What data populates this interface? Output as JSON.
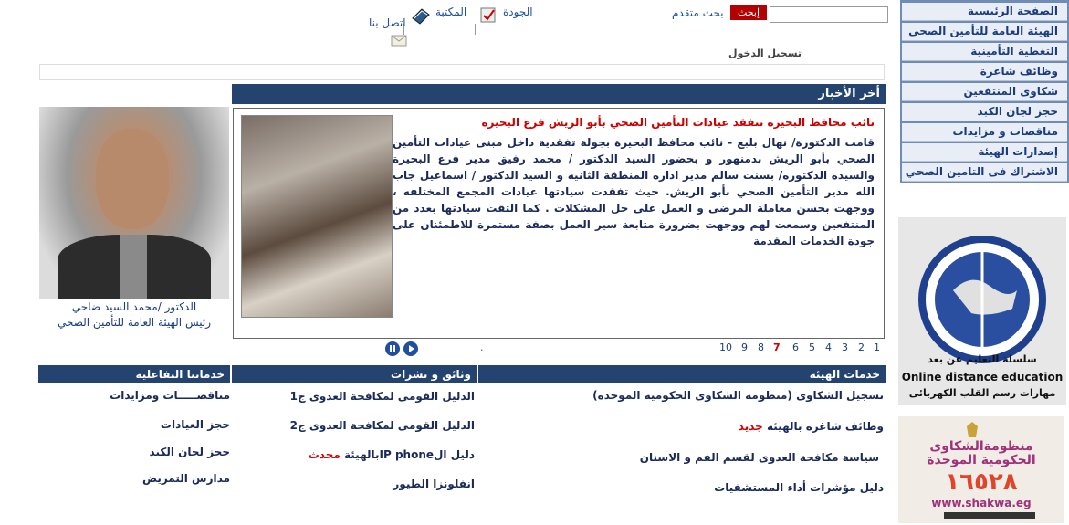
{
  "nav": {
    "items": [
      "الصفحة الرئيسية",
      "الهيئة العامة للتأمين الصحي",
      "التغطية التأمينية",
      "وظائف شاغرة",
      "شكاوى المنتفعين",
      "حجز لجان الكبد",
      "مناقصات و مزايدات",
      "إصدارات الهيئة",
      "الاشتراك فى التامين الصحي"
    ]
  },
  "header": {
    "search_button": "إبحث",
    "advanced_search": "بحث متقدم",
    "quality": "الجودة",
    "library": "المكتبة",
    "contact": "اتصل بنا",
    "login": "تسجيل الدخول"
  },
  "news": {
    "header": "أخر الأخبار",
    "title": "نائب محافظ البحيرة تتفقد عيادات التأمين الصحي بأبو الريش فرع البحيرة",
    "body": "قامت الدكتورة/ نهال بلبع - نائب محافظ البحيرة بجولة تفقدية داخل مبنى عيادات التأمين الصحي بأبو الريش بدمنهور و بحضور السيد الدكتور / محمد رفيق مدير فرع البحيرة والسيده الدكتوره/ بسنت سالم مدير اداره المنطقة الثانيه و السيد الدكتور / اسماعيل جاب الله مدير التأمين الصحي بأبو الريش. حيث تفقدت سيادتها عيادات المجمع المختلفه ، ووجهت بحسن معاملة المرضى و العمل على حل المشكلات . كما التقت سيادتها بعدد من المنتفعين وسمعت لهم ووجهت بضرورة متابعة سير العمل بصفة مستمرة للاطمئنان على جودة الخدمات المقدمة",
    "pages": [
      "1",
      "2",
      "3",
      "4",
      "5",
      "6",
      "7",
      "8",
      "9",
      "10"
    ],
    "current_page": "7",
    "dot": "."
  },
  "person": {
    "name": "الدكتور /محمد السيد ضاحي",
    "role": "رئيس الهيئة العامة للتأمين الصحي"
  },
  "columns": {
    "authority": {
      "head": "خدمات الهيئة",
      "links": [
        "تسجيل الشكاوى (منظومة الشكاوى الحكومية الموحدة)",
        "وظائف شاغرة بالهيئة",
        "سياسة مكافحة العدوى لقسم الفم و الاسنان",
        "دليل مؤشرات أداء المستشفيات"
      ],
      "new_label": "جديد"
    },
    "documents": {
      "head": "وثائق و نشرات",
      "links": [
        "الدليل القومى لمكافحة العدوى ج1",
        "الدليل القومى لمكافحة العدوى ج2",
        "دليل الIP phoneبالهيئة",
        "انفلونزا الطيور"
      ],
      "updated_label": "محدث"
    },
    "interactive": {
      "head": "خدماتنا التفاعلية",
      "links": [
        "مناقصـــــات ومزايدات",
        "حجز العيادات",
        "حجز لجان الكبد",
        "مدارس التمريض"
      ]
    }
  },
  "ads": {
    "distance": {
      "arabic_title": "سلسلة التعليم عن بعد",
      "english_title": "Online distance education",
      "subtitle": "مهارات رسم القلب الكهربائى"
    },
    "shakwa": {
      "title": "منظومةالشكاوى الحكومية الموحدة",
      "number": "١٦٥٢٨",
      "url": "www.shakwa.eg"
    }
  }
}
